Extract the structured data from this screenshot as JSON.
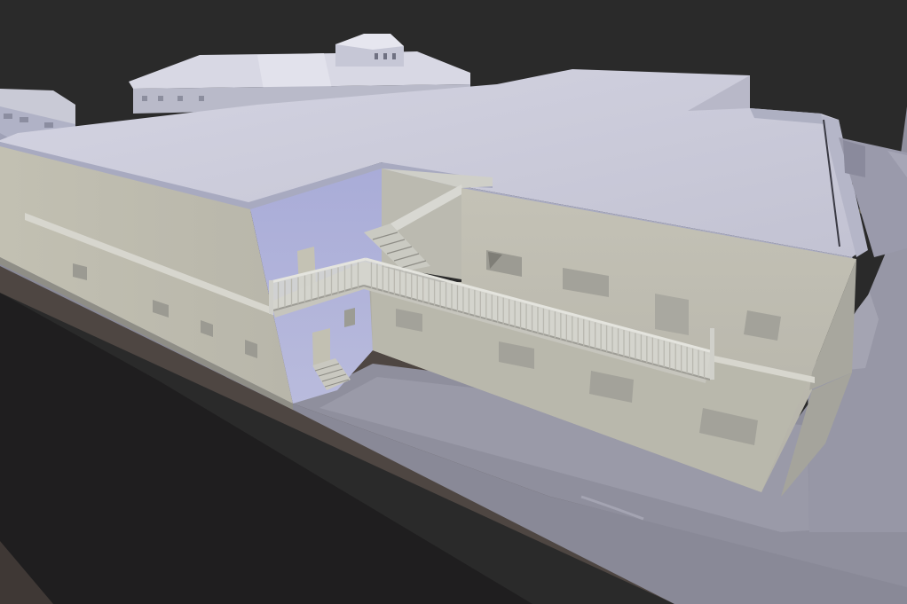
{
  "scene": {
    "kind": "3d-render",
    "subject": "untextured-building-model",
    "colors": {
      "background": "#2a2a2a",
      "ground": "#201f20",
      "terrain": "#4c4440",
      "sidewalk": "#8a8a98",
      "roof": "#c8c8d6",
      "wall-lit": "#bdbcb0",
      "wall-shade": "#a9a8a0",
      "wall-blue": "#aab0d6",
      "railing": "#d2d2cc"
    }
  }
}
